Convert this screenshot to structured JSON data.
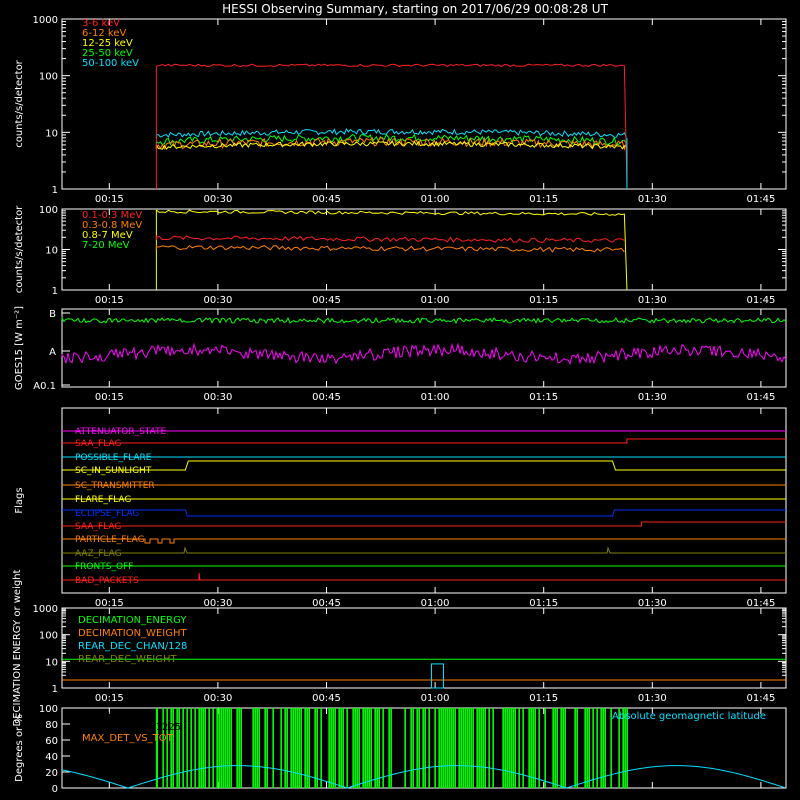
{
  "title": "HESSI Observing Summary, starting on 2017/06/29 00:08:28 UT",
  "time_ticks": [
    "00:15",
    "00:30",
    "00:45",
    "01:00",
    "01:15",
    "01:30",
    "01:45"
  ],
  "chart_data": [
    {
      "type": "line",
      "name": "counts",
      "ylabel": "counts/s/detector",
      "ylim": [
        1,
        1000
      ],
      "ylog": true,
      "ytick_labels": [
        "1",
        "10",
        "100",
        "1000"
      ],
      "xlim": [
        "00:08:28",
        "01:48:28"
      ],
      "series": [
        {
          "name": "3-6 keV",
          "color": "#ff2020",
          "x": [
            "00:21:30",
            "01:26:30"
          ],
          "y": [
            150,
            150
          ]
        },
        {
          "name": "6-12 keV",
          "color": "#ff8000",
          "x": [
            "00:21:30",
            "00:45",
            "01:26:30"
          ],
          "y": [
            7,
            8,
            7
          ]
        },
        {
          "name": "12-25 keV",
          "color": "#ffff00",
          "x": [
            "00:21:30",
            "00:45",
            "01:26:30"
          ],
          "y": [
            5,
            6,
            5
          ]
        },
        {
          "name": "25-50 keV",
          "color": "#00ff00",
          "x": [
            "00:21:30",
            "00:45",
            "01:26:30"
          ],
          "y": [
            6,
            7,
            6
          ]
        },
        {
          "name": "50-100 keV",
          "color": "#00e0ff",
          "x": [
            "00:21:30",
            "00:45",
            "01:26:30"
          ],
          "y": [
            8,
            10,
            8
          ]
        }
      ]
    },
    {
      "type": "line",
      "name": "counts_mev",
      "ylabel": "counts/s/detector",
      "ylim": [
        1,
        100
      ],
      "ylog": true,
      "ytick_labels": [
        "1",
        "10",
        "100"
      ],
      "series": [
        {
          "name": "0.1-0.3 MeV",
          "color": "#ff2020",
          "x": [
            "00:21:30",
            "00:45",
            "01:26:30"
          ],
          "y": [
            17,
            21,
            17
          ]
        },
        {
          "name": "0.3-0.8 MeV",
          "color": "#ff8000",
          "x": [
            "00:21:30",
            "00:45",
            "01:26:30"
          ],
          "y": [
            11,
            13,
            10
          ]
        },
        {
          "name": "0.8-7 MeV",
          "color": "#ffff00",
          "x": [
            "00:21:30",
            "00:45",
            "01:26:30"
          ],
          "y": [
            90,
            85,
            75
          ]
        },
        {
          "name": "7-20 MeV",
          "color": "#00ff00",
          "x": [],
          "y": []
        }
      ]
    },
    {
      "type": "line",
      "name": "goes",
      "ylabel": "GOES15 [W m⁻²]",
      "ytick_labels": [
        "A0.1",
        "A",
        "B"
      ],
      "series": [
        {
          "color": "#00ff00",
          "y": [
            1.5e-07,
            1.5e-07
          ]
        },
        {
          "color": "#ff00ff",
          "y": [
            3.5e-08,
            3.5e-08
          ]
        }
      ]
    },
    {
      "type": "step",
      "name": "flags",
      "ylabel": "Flags",
      "flags": [
        {
          "name": "ATTENUATOR_STATE",
          "color": "#ff00ff",
          "transitions": []
        },
        {
          "name": "SAA_FLAG",
          "color": "#ff2020",
          "high_from": "01:26:30"
        },
        {
          "name": "POSSIBLE_FLARE",
          "color": "#00e0ff",
          "transitions": []
        },
        {
          "name": "SC_IN_SUNLIGHT",
          "color": "#ffff00",
          "high_from": "00:25:30",
          "high_to": "01:24:30"
        },
        {
          "name": "SC_TRANSMITTER",
          "color": "#ff8000",
          "transitions": []
        },
        {
          "name": "FLARE_FLAG",
          "color": "#ffff00",
          "transitions": []
        },
        {
          "name": "ECLIPSE_FLAG",
          "color": "#0030ff",
          "high_until": "00:25:30",
          "high_from": "01:24:30"
        },
        {
          "name": "SAA_FLAG",
          "color": "#ff2020",
          "high_from": "01:28:30"
        },
        {
          "name": "PARTICLE_FLAG",
          "color": "#ff8000"
        },
        {
          "name": "AAZ_FLAG",
          "color": "#808000"
        },
        {
          "name": "FRONTS_OFF",
          "color": "#00ff00"
        },
        {
          "name": "BAD_PACKETS",
          "color": "#ff2020"
        }
      ]
    },
    {
      "type": "line",
      "name": "decimation",
      "ylabel": "DECIMATION ENERGY or weight",
      "ylim": [
        1,
        1000
      ],
      "ylog": true,
      "ytick_labels": [
        "1",
        "10",
        "100",
        "1000"
      ],
      "series": [
        {
          "name": "DECIMATION_ENERGY",
          "color": "#00ff00",
          "y": [
            12
          ]
        },
        {
          "name": "DECIMATION_WEIGHT",
          "color": "#ff8000",
          "y": [
            2
          ]
        },
        {
          "name": "REAR_DEC_CHAN/128",
          "color": "#00e0ff",
          "y": []
        },
        {
          "name": "REAR_DEC_WEIGHT",
          "color": "#808000",
          "y": []
        }
      ]
    },
    {
      "type": "line",
      "name": "ratio",
      "ylabel": "Degrees or %",
      "ylim": [
        0,
        100
      ],
      "ytick_labels": [
        "0",
        "20",
        "40",
        "60",
        "80",
        "100"
      ],
      "series": [
        {
          "name": "FRONT_RATIO",
          "color": "#00ff00",
          "x": [
            "00:21:30",
            "01:26:30"
          ],
          "y": [
            100,
            100
          ]
        },
        {
          "name": "FRONT_RATIO_1225",
          "color": "#00ff00",
          "y": []
        },
        {
          "name": "MAX_DET_VS_TOT",
          "color": "#ff8000",
          "y": []
        },
        {
          "name": "Absolute geomagnetic latitude",
          "color": "#00e0ff",
          "x": [
            "00:08:28",
            "00:27",
            "00:56",
            "01:23",
            "01:42",
            "01:48:28"
          ],
          "y": [
            24,
            0,
            28,
            0,
            28,
            20
          ]
        }
      ]
    }
  ]
}
